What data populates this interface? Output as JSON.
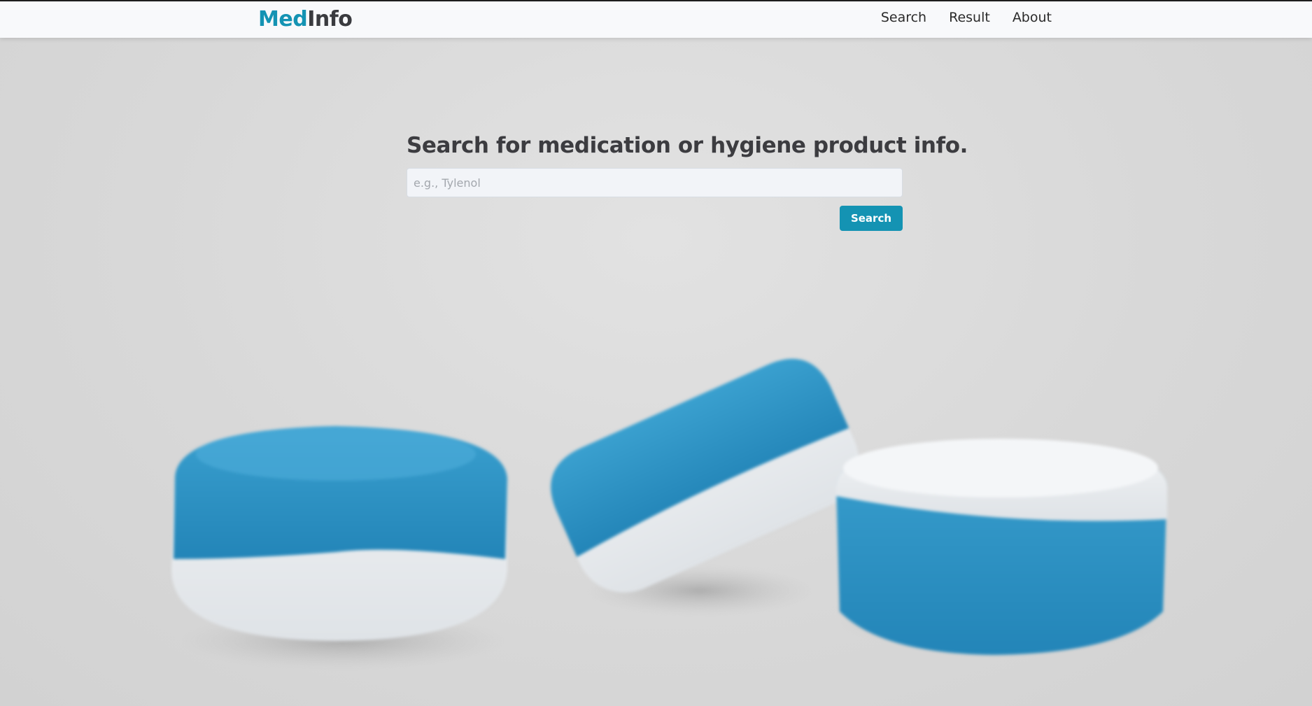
{
  "brand": {
    "part1": "Med",
    "part2": "Info"
  },
  "nav": {
    "search": "Search",
    "result": "Result",
    "about": "About"
  },
  "hero": {
    "title": "Search for medication or hygiene product info.",
    "search_placeholder": "e.g., Tylenol",
    "search_value": "",
    "search_button": "Search"
  },
  "colors": {
    "accent": "#1493b3",
    "text_dark": "#3c3c40",
    "navbar_bg": "#f8f9fb",
    "pill_blue": "#2f8fc0"
  },
  "background_image": "blurred photo of three blue-and-white tablets"
}
